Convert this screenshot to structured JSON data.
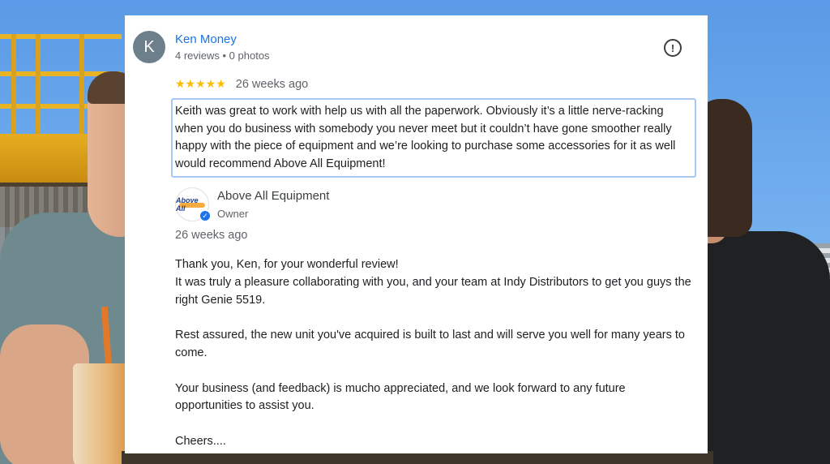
{
  "review": {
    "reviewer": {
      "initial": "K",
      "name": "Ken Money",
      "meta": "4 reviews • 0 photos"
    },
    "rating_stars": 5,
    "stars_glyph": "★★★★★",
    "date": "26 weeks ago",
    "text": "Keith was great to work with help us with all the paperwork. Obviously it’s a little nerve-racking when you do business with somebody you never meet but it couldn’t have gone smoother really happy with the piece of equipment and we’re looking to purchase some accessories for it as well would recommend Above All Equipment!",
    "flag_icon": "!"
  },
  "owner_reply": {
    "name": "Above All Equipment",
    "role": "Owner",
    "logo_text": "Above All",
    "date": "26 weeks ago",
    "paragraphs": {
      "p1_line1": "Thank you, Ken, for your wonderful review!",
      "p1_line2": "It was truly a pleasure collaborating with you, and your team at Indy Distributors to get you guys the right Genie 5519.",
      "p2": "Rest assured, the new unit you've acquired is built to last and will serve you well for many years to come.",
      "p3": "Your business (and feedback) is mucho appreciated, and we look forward to any future opportunities to assist you.",
      "p4": "Cheers...."
    }
  },
  "colors": {
    "reviewer_name": "#1a73e8",
    "stars": "#fbbc04",
    "avatar_bg": "#6e7f8c",
    "highlight_border": "#a7c7f5"
  }
}
